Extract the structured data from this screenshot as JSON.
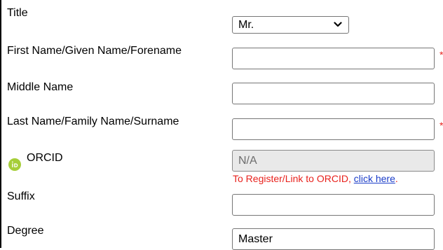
{
  "form": {
    "title": {
      "label": "Title",
      "selected": "Mr."
    },
    "first_name": {
      "label": "First Name/Given Name/Forename",
      "value": "",
      "required_marker": "*"
    },
    "middle_name": {
      "label": "Middle Name",
      "value": ""
    },
    "last_name": {
      "label": "Last Name/Family Name/Surname",
      "value": "",
      "required_marker": "*"
    },
    "orcid": {
      "label": "ORCID",
      "value": "N/A",
      "note_prefix": "To Register/Link to ORCID, ",
      "note_link": "click here",
      "note_suffix": "."
    },
    "suffix": {
      "label": "Suffix",
      "value": ""
    },
    "degree": {
      "label": "Degree",
      "value": "Master"
    }
  },
  "colors": {
    "required": "#e8211c",
    "link": "#1a3cc8",
    "orcid_brand": "#a6ce39"
  },
  "icons": {
    "orcid": "orcid-icon",
    "dropdown": "chevron-down-icon"
  }
}
